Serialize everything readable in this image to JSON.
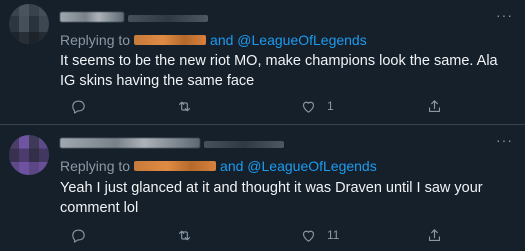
{
  "tweets": [
    {
      "replying_to_prefix": "Replying to",
      "replying_to_and": "and",
      "replying_to_handle": "@LeagueOfLegends",
      "text": "It seems to be the new riot MO, make champions look the same. Ala IG skins having the same face",
      "like_count": "1",
      "more_label": "···"
    },
    {
      "replying_to_prefix": "Replying to",
      "replying_to_and": "and",
      "replying_to_handle": "@LeagueOfLegends",
      "text": "Yeah I just glanced at it and thought it was Draven until I saw your comment lol",
      "like_count": "11",
      "more_label": "···"
    }
  ],
  "colors": {
    "background": "#15202b",
    "link": "#1d9bf0",
    "secondary_text": "#8b98a5",
    "primary_text": "#f1f3f5",
    "divider": "#38444d"
  },
  "icons": [
    "reply-icon",
    "retweet-icon",
    "like-icon",
    "share-icon",
    "more-icon"
  ]
}
